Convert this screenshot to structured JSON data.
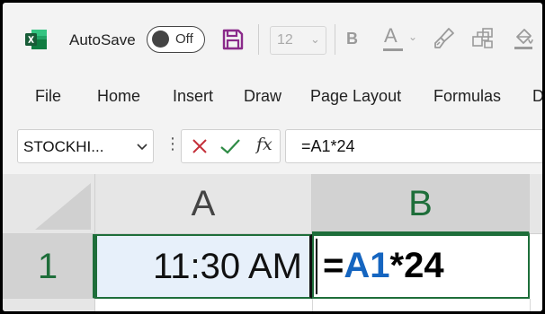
{
  "toolbar": {
    "app_icon": "excel-logo-icon",
    "autosave_label": "AutoSave",
    "autosave_state": "Off",
    "font_size": "12",
    "bold_label": "B",
    "font_color_label": "A"
  },
  "tabs": [
    "File",
    "Home",
    "Insert",
    "Draw",
    "Page Layout",
    "Formulas",
    "D"
  ],
  "formula_bar": {
    "name_box": "STOCKHI...",
    "fx_label": "fx",
    "formula": "=A1*24"
  },
  "grid": {
    "columns": [
      "A",
      "B"
    ],
    "rows": [
      "1"
    ],
    "cells": {
      "A1": "11:30 AM",
      "B1_prefix": "=",
      "B1_ref": "A1",
      "B1_suffix": "*24"
    }
  },
  "colors": {
    "excel_green": "#1e6e3a",
    "reference_blue": "#1565c0",
    "save_purple": "#8a2a8a"
  }
}
